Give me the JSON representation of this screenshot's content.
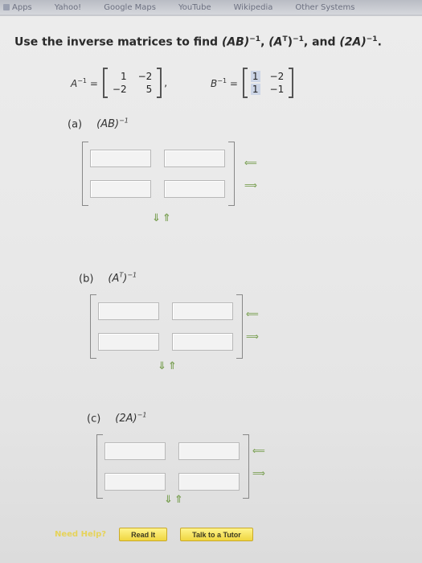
{
  "bookmarks": [
    {
      "label": "Apps"
    },
    {
      "label": "Yahoo!"
    },
    {
      "label": "Google Maps"
    },
    {
      "label": "YouTube"
    },
    {
      "label": "Wikipedia"
    },
    {
      "label": "Other Systems"
    }
  ],
  "question": {
    "prefix": "Use the inverse matrices to find ",
    "t1": "(AB)",
    "exp": "−1",
    "sep": ", ",
    "t2": "(A",
    "t2sup": "T",
    "t2close": ")",
    "t3": "(2A)",
    "and": ", and ",
    "end": "."
  },
  "given": {
    "a_label": "A",
    "a_exp": "−1",
    "eq": " =",
    "a_matrix": [
      [
        "1",
        "−2"
      ],
      [
        "−2",
        "5"
      ]
    ],
    "comma": ",",
    "b_label": "B",
    "b_exp": "−1",
    "b_matrix": [
      [
        "1",
        "−2"
      ],
      [
        "1",
        "−1"
      ]
    ]
  },
  "parts": [
    {
      "letter": "(a)",
      "expr": "(AB)",
      "sup_t": "",
      "exp": "−1"
    },
    {
      "letter": "(b)",
      "expr": "(A",
      "sup_t": "T",
      "close": ")",
      "exp": "−1"
    },
    {
      "letter": "(c)",
      "expr": "(2A)",
      "sup_t": "",
      "exp": "−1"
    }
  ],
  "arrows": {
    "col_up": "⟸",
    "col_down": "⟹",
    "rows": "⇓⇑"
  },
  "buttons": {
    "need_help": "Need Help?",
    "read_it": "Read It",
    "talk": "Talk to a Tutor"
  },
  "colors": {
    "accent_green": "#7fa35a",
    "button_yellow": "#f0d640",
    "cell_shade": "#ccd5e6"
  }
}
